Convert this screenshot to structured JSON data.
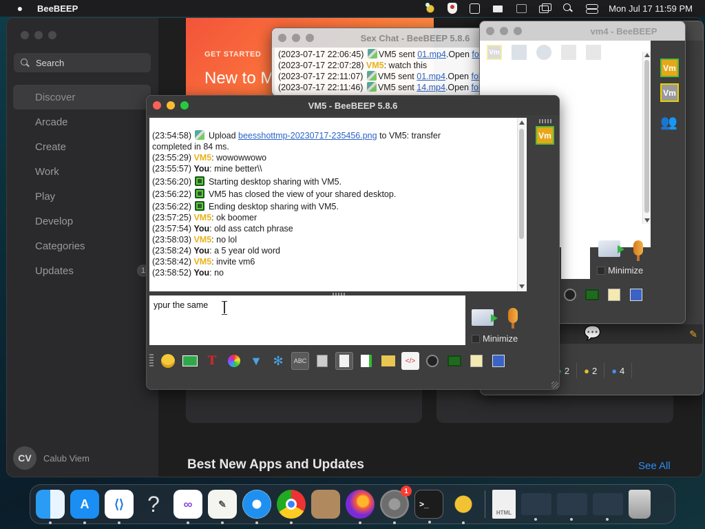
{
  "menubar": {
    "app_name": "BeeBEEP",
    "clock": "Mon Jul 17  11:59 PM"
  },
  "appstore": {
    "search_label": "Search",
    "nav": [
      {
        "label": "Discover",
        "active": true
      },
      {
        "label": "Arcade"
      },
      {
        "label": "Create"
      },
      {
        "label": "Work"
      },
      {
        "label": "Play"
      },
      {
        "label": "Develop"
      },
      {
        "label": "Categories"
      },
      {
        "label": "Updates",
        "badge": "1"
      }
    ],
    "user_initials": "CV",
    "user_name": "Calub Viem",
    "hero_eyebrow": "GET STARTED",
    "hero_title": "New to M",
    "section_title": "Best New Apps and Updates",
    "see_all": "See All"
  },
  "sexchat": {
    "title": "Sex Chat - BeeBEEP 5.8.6",
    "lines": [
      {
        "time": "(2023-07-17 22:06:45)",
        "nick": "VM5",
        "pre": "sent ",
        "link": "01.mp4",
        "mid": ".Open ",
        "link2": "folder",
        "post": "."
      },
      {
        "time": "(2023-07-17 22:07:28)",
        "nick": "VM5",
        "text": ": watch this"
      },
      {
        "time": "(2023-07-17 22:11:07)",
        "nick": "VM5",
        "pre": "sent ",
        "link": "01.mp4",
        "mid": ".Open ",
        "link2": "folder",
        "post": "."
      },
      {
        "time": "(2023-07-17 22:11:46)",
        "nick": "VM5",
        "pre": "sent ",
        "link": "14.mp4",
        "mid": ".Open ",
        "link2": "folder",
        "post": "."
      }
    ]
  },
  "vm4": {
    "title": "vm4 - BeeBEEP",
    "minimize_label": "Minimize",
    "avatar1": "Vm",
    "avatar2": "Vm"
  },
  "main_window": {
    "status_tabs": [
      "2",
      "2",
      "4"
    ]
  },
  "vm5": {
    "title": "VM5 - BeeBEEP 5.8.6",
    "avatar": "Vm",
    "minimize_label": "Minimize",
    "input_text": "ypur the same",
    "log": [
      {
        "time": "(23:54:58)",
        "icon": "upload",
        "text": " Upload ",
        "link": "beesshottmp-20230717-235456.png",
        "post": " to VM5: transfer"
      },
      {
        "time": "",
        "text": "completed in 84 ms."
      },
      {
        "time": "(23:55:29)",
        "nick": "VM5",
        "kind": "vm5",
        "text": ": wowowwowo"
      },
      {
        "time": "(23:55:57)",
        "nick": "You",
        "kind": "you",
        "text": ": mine better\\\\"
      },
      {
        "time": "(23:56:20)",
        "icon": "screen",
        "text": " Starting desktop sharing with VM5."
      },
      {
        "time": "(23:56:22)",
        "icon": "screen",
        "text": " VM5 has closed the view of your shared desktop."
      },
      {
        "time": "(23:56:22)",
        "icon": "screen",
        "text": " Ending desktop sharing with VM5."
      },
      {
        "time": "(23:57:25)",
        "nick": "VM5",
        "kind": "vm5",
        "text": ": ok boomer"
      },
      {
        "time": "(23:57:54)",
        "nick": "You",
        "kind": "you",
        "text": ": old ass catch phrase"
      },
      {
        "time": "(23:58:03)",
        "nick": "VM5",
        "kind": "vm5",
        "text": ": no lol"
      },
      {
        "time": "(23:58:24)",
        "nick": "You",
        "kind": "you",
        "text": ": a 5 year old word"
      },
      {
        "time": "(23:58:42)",
        "nick": "VM5",
        "kind": "vm5",
        "text": ": invite vm6"
      },
      {
        "time": "(23:58:52)",
        "nick": "You",
        "kind": "you",
        "text": ": no"
      }
    ]
  },
  "colors": {
    "vm5_nick": "#e8b21c",
    "link": "#2a63c7",
    "appstore_link": "#2f8cf3",
    "hero_orange": "#f2543a"
  },
  "icons": {
    "toolbar": [
      "emoji-icon",
      "email-icon",
      "font-icon",
      "color-icon",
      "filter-icon",
      "settings-icon",
      "spellcheck-icon",
      "dictionary-icon",
      "clipboard-icon",
      "send-file-icon",
      "send-folder-icon",
      "html-icon",
      "screenshot-icon",
      "share-desktop-icon",
      "note-icon",
      "save-icon"
    ],
    "dock": [
      "finder-icon",
      "app-store-icon",
      "vscode-icon",
      "help-icon",
      "visual-studio-icon",
      "textedit-icon",
      "safari-icon",
      "chrome-icon",
      "archive-icon",
      "firefox-icon",
      "system-settings-icon",
      "terminal-icon",
      "beebeep-icon",
      "html-file-icon",
      "window-thumbnail-icon",
      "window-thumbnail-icon",
      "window-thumbnail-icon",
      "trash-icon"
    ]
  },
  "dock_badges": {
    "system_settings": "1"
  }
}
